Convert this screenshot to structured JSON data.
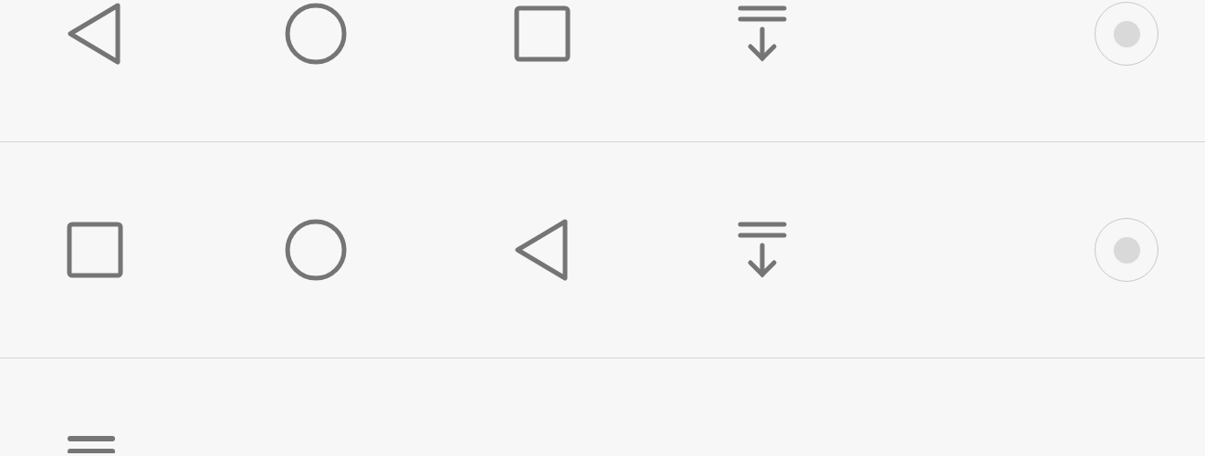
{
  "layouts": [
    {
      "buttons": [
        {
          "kind": "back"
        },
        {
          "kind": "home"
        },
        {
          "kind": "recents"
        },
        {
          "kind": "notifications"
        }
      ],
      "selected": true,
      "disabled": true
    },
    {
      "buttons": [
        {
          "kind": "recents"
        },
        {
          "kind": "home"
        },
        {
          "kind": "back"
        },
        {
          "kind": "notifications"
        }
      ],
      "selected": true,
      "disabled": true
    }
  ],
  "next_row": {
    "kind": "menu"
  }
}
